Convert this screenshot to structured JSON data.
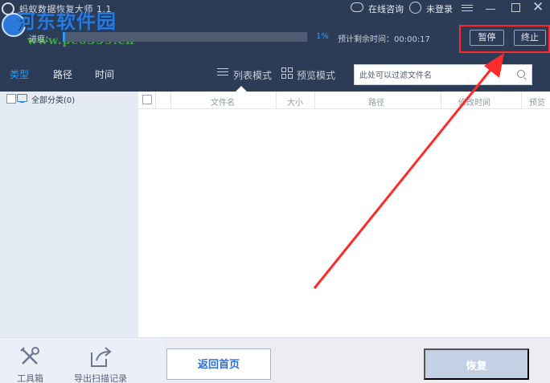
{
  "window": {
    "title": "蚂蚁数据恢复大师 1.1",
    "online_consult": "在线咨询",
    "login": "未登录"
  },
  "watermark": {
    "name": "河东软件园",
    "url": "www.pc0359.cn"
  },
  "scan": {
    "progress_label": "进度：",
    "progress_value": 0.01,
    "percent": "1%",
    "remaining": "预计剩余时间：00:00:17",
    "pause": "暂停",
    "stop": "终止"
  },
  "tabs": [
    {
      "label": "类型",
      "active": true
    },
    {
      "label": "路径",
      "active": false
    },
    {
      "label": "时间",
      "active": false
    }
  ],
  "modes": {
    "list": "列表模式",
    "preview": "预览模式"
  },
  "search": {
    "placeholder": "此处可以过滤文件名"
  },
  "tree": {
    "all": "全部分类(0)"
  },
  "table": {
    "columns": [
      "文件名",
      "大小",
      "路径",
      "修改时间",
      "预览"
    ]
  },
  "footer": {
    "toolbox": "工具箱",
    "export": "导出扫描记录",
    "home": "返回首页",
    "restore": "恢复"
  },
  "colors": {
    "titlebar": "#2c3c56",
    "accent": "#2d9cf5",
    "annotation": "#ff2a2a",
    "restore_disabled": "#c4d1e4"
  }
}
